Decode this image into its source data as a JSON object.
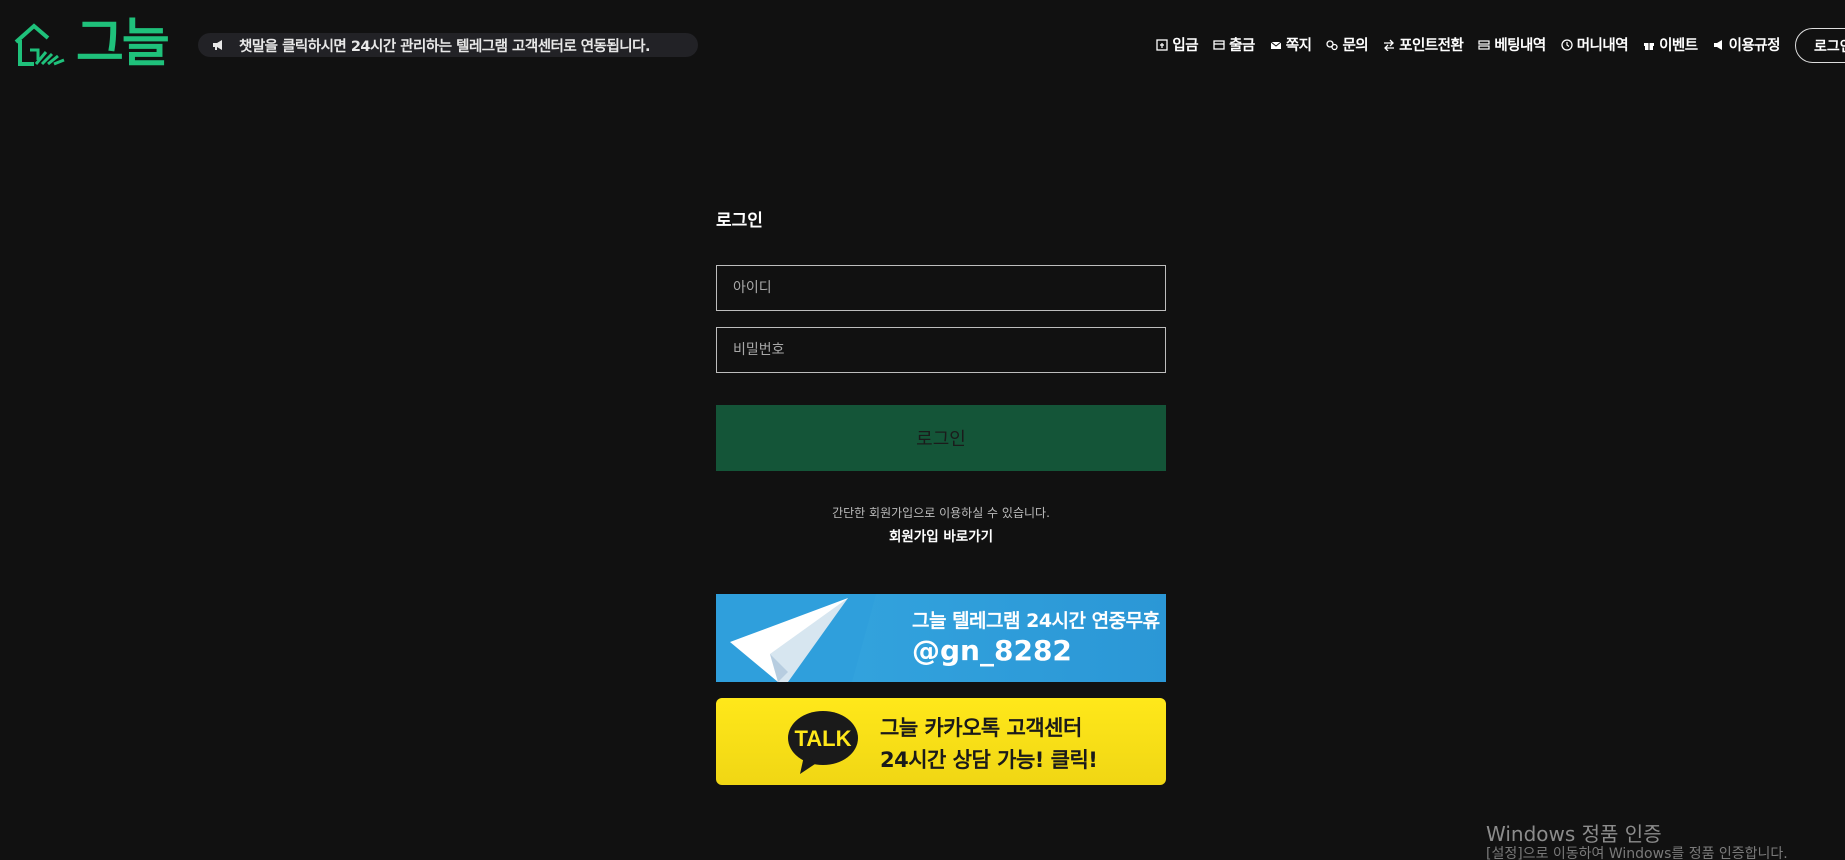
{
  "header": {
    "logo_text": "그늘",
    "notice": "챗말을 클릭하시면 24시간 관리하는 텔레그램 고객센터로 연동됩니다.",
    "nav": [
      {
        "label": "입금",
        "icon": "deposit-icon"
      },
      {
        "label": "출금",
        "icon": "withdraw-icon"
      },
      {
        "label": "쪽지",
        "icon": "mail-icon"
      },
      {
        "label": "문의",
        "icon": "inquiry-icon"
      },
      {
        "label": "포인트전환",
        "icon": "exchange-icon"
      },
      {
        "label": "베팅내역",
        "icon": "list-icon"
      },
      {
        "label": "머니내역",
        "icon": "clock-icon"
      },
      {
        "label": "이벤트",
        "icon": "gift-icon"
      },
      {
        "label": "이용규정",
        "icon": "megaphone-icon"
      }
    ],
    "login_button": "로그인"
  },
  "login": {
    "title": "로그인",
    "id_placeholder": "아이디",
    "pw_placeholder": "비밀번호",
    "submit_label": "로그인",
    "signup_hint": "간단한 회원가입으로 이용하실 수 있습니다.",
    "signup_link": "회원가입 바로가기"
  },
  "banners": {
    "telegram_line1": "그늘 텔레그램 24시간 연중무휴",
    "telegram_line2": "@gn_8282",
    "kakao_badge": "TALK",
    "kakao_line1": "그늘 카카오톡 고객센터",
    "kakao_line2": "24시간 상담 가능! 클릭!"
  },
  "watermark": {
    "line1": "Windows 정품 인증",
    "line2": "[설정]으로 이동하여 Windows를 정품 인증합니다."
  },
  "colors": {
    "background": "#111111",
    "brand_green": "#1fc17b",
    "login_button": "#145538",
    "telegram_blue": "#2b97d6",
    "kakao_yellow": "#ffe81a"
  }
}
